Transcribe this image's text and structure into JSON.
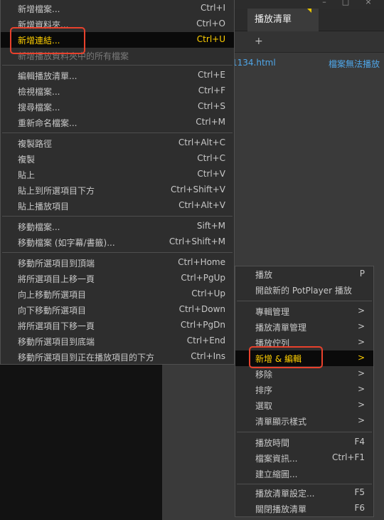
{
  "window": {
    "tab_label": "播放清單",
    "add_tab": "+",
    "file_name": "1134.html",
    "file_status": "檔案無法播放"
  },
  "left_menu": {
    "items": [
      {
        "label": "新增檔案...",
        "shortcut": "Ctrl+I"
      },
      {
        "label": "新增資料夾...",
        "shortcut": "Ctrl+O"
      },
      {
        "label": "新增連結...",
        "shortcut": "Ctrl+U"
      },
      {
        "label": "新增播放資料夾中的所有檔案",
        "shortcut": ""
      },
      {
        "label": "編輯播放清單...",
        "shortcut": "Ctrl+E"
      },
      {
        "label": "檢視檔案...",
        "shortcut": "Ctrl+F"
      },
      {
        "label": "搜尋檔案...",
        "shortcut": "Ctrl+S"
      },
      {
        "label": "重新命名檔案...",
        "shortcut": "Ctrl+M"
      },
      {
        "label": "複製路徑",
        "shortcut": "Ctrl+Alt+C"
      },
      {
        "label": "複製",
        "shortcut": "Ctrl+C"
      },
      {
        "label": "貼上",
        "shortcut": "Ctrl+V"
      },
      {
        "label": "貼上到所選項目下方",
        "shortcut": "Ctrl+Shift+V"
      },
      {
        "label": "貼上播放項目",
        "shortcut": "Ctrl+Alt+V"
      },
      {
        "label": "移動檔案...",
        "shortcut": "Sift+M"
      },
      {
        "label": "移動檔案 (如字幕/書籤)...",
        "shortcut": "Ctrl+Shift+M"
      },
      {
        "label": "移動所選項目到頂端",
        "shortcut": "Ctrl+Home"
      },
      {
        "label": "將所選項目上移一頁",
        "shortcut": "Ctrl+PgUp"
      },
      {
        "label": "向上移動所選項目",
        "shortcut": "Ctrl+Up"
      },
      {
        "label": "向下移動所選項目",
        "shortcut": "Ctrl+Down"
      },
      {
        "label": "將所選項目下移一頁",
        "shortcut": "Ctrl+PgDn"
      },
      {
        "label": "移動所選項目到底端",
        "shortcut": "Ctrl+End"
      },
      {
        "label": "移動所選項目到正在播放項目的下方",
        "shortcut": "Ctrl+Ins"
      }
    ]
  },
  "context_menu": {
    "items": [
      {
        "label": "播放",
        "shortcut": "P"
      },
      {
        "label": "開啟新的 PotPlayer 播放",
        "shortcut": ""
      },
      {
        "label": "專輯管理",
        "shortcut": ">"
      },
      {
        "label": "播放清單管理",
        "shortcut": ">"
      },
      {
        "label": "播放佇列",
        "shortcut": ">"
      },
      {
        "label": "新增 & 編輯",
        "shortcut": ">"
      },
      {
        "label": "移除",
        "shortcut": ">"
      },
      {
        "label": "排序",
        "shortcut": ">"
      },
      {
        "label": "選取",
        "shortcut": ">"
      },
      {
        "label": "清單顯示樣式",
        "shortcut": ">"
      },
      {
        "label": "播放時間",
        "shortcut": "F4"
      },
      {
        "label": "檔案資訊...",
        "shortcut": "Ctrl+F1"
      },
      {
        "label": "建立縮圖...",
        "shortcut": ""
      },
      {
        "label": "播放清單設定...",
        "shortcut": "F5"
      },
      {
        "label": "關閉播放清單",
        "shortcut": "F6"
      }
    ]
  },
  "colors": {
    "highlight_text": "#ffcf00",
    "annotation_box": "#e8412c",
    "link_text": "#4fa6e8"
  }
}
